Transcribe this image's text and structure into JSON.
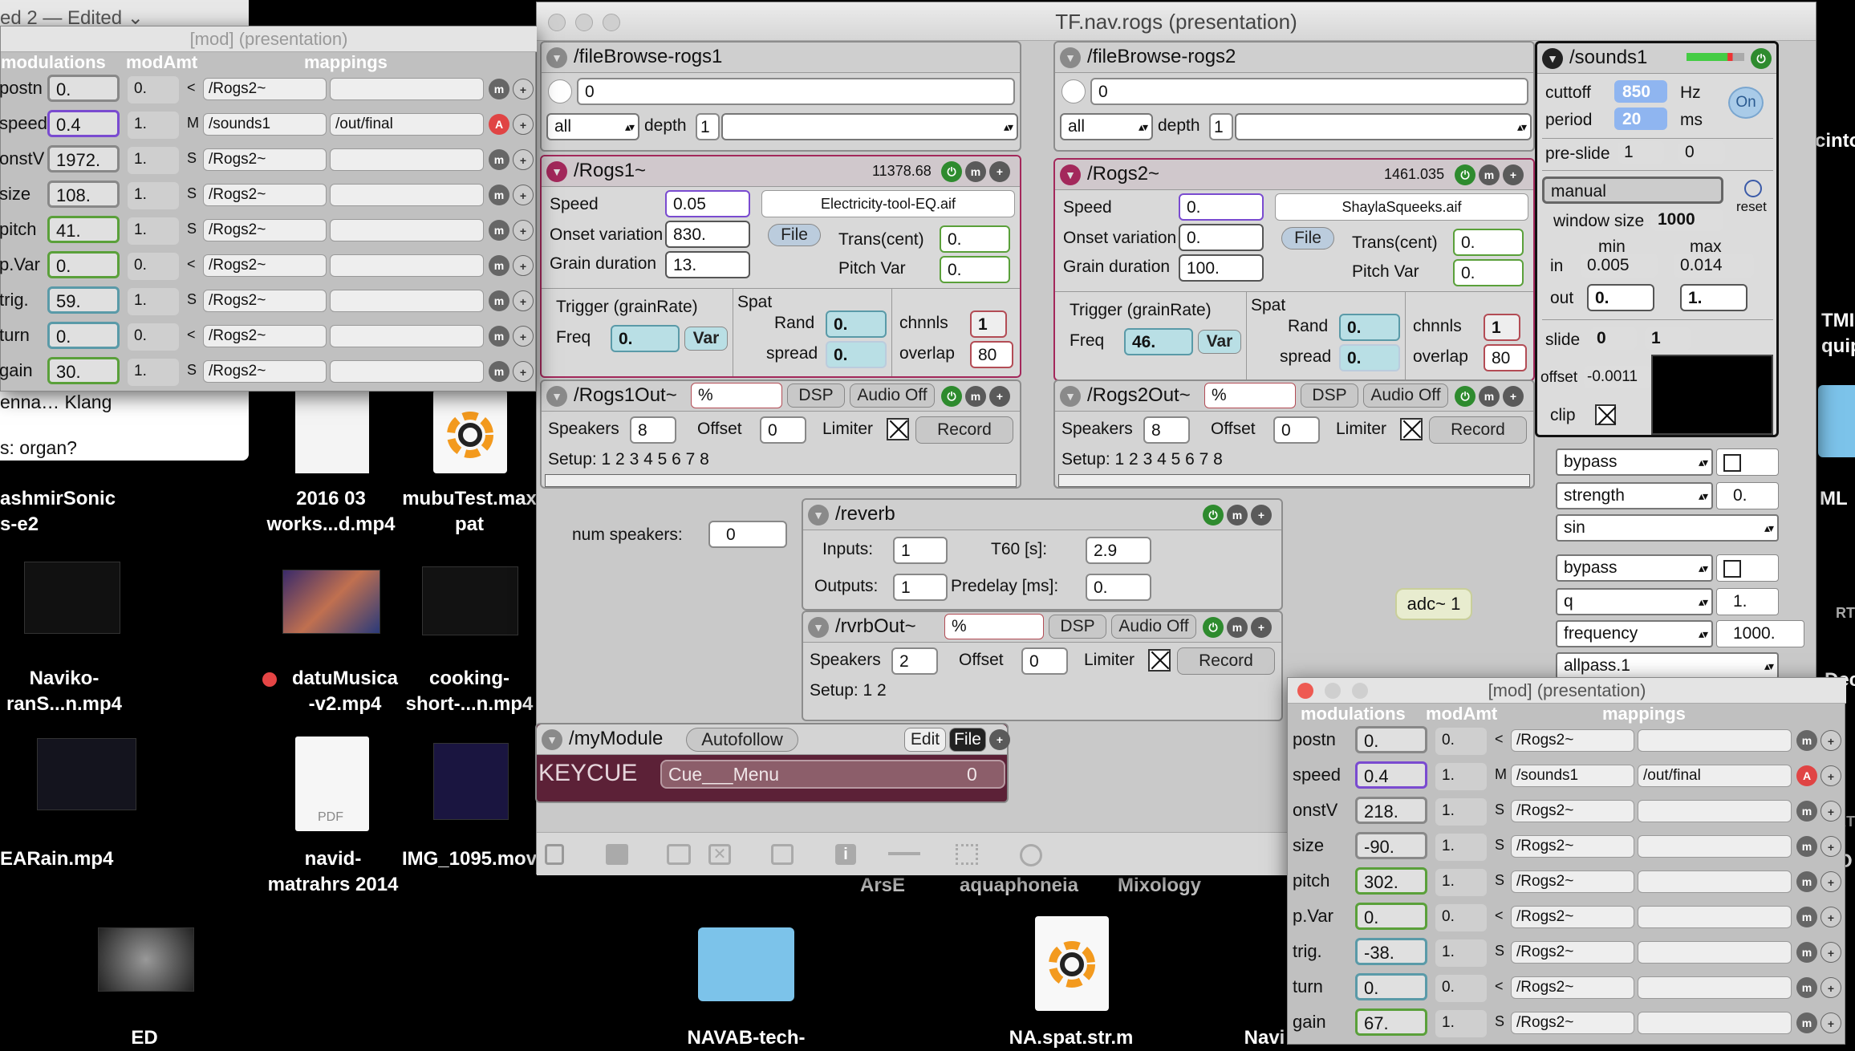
{
  "desktop": {
    "labels": {
      "kashmir": "ashmirSonic\ns-e2",
      "works": "2016 03\nworks...d.mp4",
      "mubu": "mubuTest.max\npat",
      "naviko": "Naviko-\nranS...n.mp4",
      "datum": "datuMusica\n-v2.mp4",
      "cooking": "cooking-\nshort-...n.mp4",
      "eararain": "EARain.mp4",
      "navid": "navid-\nmatrahrs 2014",
      "img": "IMG_1095.mov",
      "arse": "ArsE",
      "aqua": "aquaphoneia",
      "mix": "Mixology",
      "ed": "ED",
      "navab": "NAVAB-tech-",
      "naspat": "NA.spat.str.m",
      "navi": "Navi",
      "pdf": "PDF",
      "cinto": "cinto",
      "tmi": "TMI\nquipr",
      "ml": "ML",
      "rt": "RT",
      "dec": "Dec",
      "rt2": "RT",
      "o": "O"
    },
    "note_window": {
      "title": "ed 2 — Edited ⌄",
      "line1": "enna… Klang",
      "line2": "s: organ?"
    }
  },
  "main_window": {
    "title": "TF.nav.rogs (presentation)",
    "fb1": {
      "name": "/fileBrowse-rogs1",
      "path": "0",
      "filter": "all",
      "depth_label": "depth",
      "depth": "1"
    },
    "fb2": {
      "name": "/fileBrowse-rogs2",
      "path": "0",
      "filter": "all",
      "depth_label": "depth",
      "depth": "1"
    },
    "rogs1": {
      "name": "/Rogs1~",
      "time": "11378.68",
      "speed_label": "Speed",
      "speed": "0.05",
      "onset_label": "Onset variation",
      "onset": "830.",
      "grain_label": "Grain duration",
      "grain": "13.",
      "file_name": "Electricity-tool-EQ.aif",
      "file_btn": "File",
      "trans_label": "Trans(cent)",
      "trans": "0.",
      "pitchvar_label": "Pitch Var",
      "pitchvar": "0.",
      "trigger_label": "Trigger (grainRate)",
      "freq_label": "Freq",
      "freq": "0.",
      "var_btn": "Var",
      "spat_label": "Spat",
      "rand_label": "Rand",
      "rand": "0.",
      "spread_label": "spread",
      "spread": "0.",
      "chnls_label": "chnnls",
      "chnls": "1",
      "overlap_label": "overlap",
      "overlap": "80"
    },
    "rogs2": {
      "name": "/Rogs2~",
      "time": "1461.035",
      "speed_label": "Speed",
      "speed": "0.",
      "onset_label": "Onset variation",
      "onset": "0.",
      "grain_label": "Grain duration",
      "grain": "100.",
      "file_name": "ShaylaSqueeks.aif",
      "file_btn": "File",
      "trans_label": "Trans(cent)",
      "trans": "0.",
      "pitchvar_label": "Pitch Var",
      "pitchvar": "0.",
      "trigger_label": "Trigger (grainRate)",
      "freq_label": "Freq",
      "freq": "46.",
      "var_btn": "Var",
      "spat_label": "Spat",
      "rand_label": "Rand",
      "rand": "0.",
      "spread_label": "spread",
      "spread": "0.",
      "chnls_label": "chnnls",
      "chnls": "1",
      "overlap_label": "overlap",
      "overlap": "80"
    },
    "out1": {
      "name": "/Rogs1Out~",
      "pct": "%",
      "dsp": "DSP",
      "audio": "Audio Off",
      "spk_label": "Speakers",
      "spk": "8",
      "off_label": "Offset",
      "off": "0",
      "lim_label": "Limiter",
      "rec": "Record",
      "setup": "Setup:  1 2 3 4 5 6 7 8"
    },
    "out2": {
      "name": "/Rogs2Out~",
      "pct": "%",
      "dsp": "DSP",
      "audio": "Audio Off",
      "spk_label": "Speakers",
      "spk": "8",
      "off_label": "Offset",
      "off": "0",
      "lim_label": "Limiter",
      "rec": "Record",
      "setup": "Setup:  1 2 3 4 5 6 7 8"
    },
    "num_speakers_label": "num speakers:",
    "num_speakers": "0",
    "reverb": {
      "name": "/reverb",
      "in_label": "Inputs:",
      "inputs": "1",
      "out_label": "Outputs:",
      "outputs": "1",
      "t60_label": "T60 [s]:",
      "t60": "2.9",
      "pre_label": "Predelay [ms]:",
      "predelay": "0."
    },
    "rvrbout": {
      "name": "/rvrbOut~",
      "pct": "%",
      "dsp": "DSP",
      "audio": "Audio Off",
      "spk_label": "Speakers",
      "spk": "2",
      "off_label": "Offset",
      "off": "0",
      "lim_label": "Limiter",
      "rec": "Record",
      "setup": "Setup:  1 2"
    },
    "adc": "adc~ 1",
    "mymodule": {
      "name": "/myModule",
      "autofollow": "Autofollow",
      "edit": "Edit",
      "file": "File",
      "keycue": "KEYCUE",
      "cue_menu": "Cue___Menu",
      "cue_num": "0"
    },
    "sounds1": {
      "name": "/sounds1",
      "cutoff_label": "cuttoff",
      "cutoff": "850",
      "hz": "Hz",
      "period_label": "period",
      "period": "20",
      "ms": "ms",
      "on": "On",
      "preslide_label": "pre-slide",
      "preslide": "1",
      "preslide2": "0",
      "mode": "manual",
      "reset": "reset",
      "window_label": "window size",
      "window": "1000",
      "min_label": "min",
      "max_label": "max",
      "in_label": "in",
      "in_min": "0.005",
      "in_max": "0.014",
      "out_label": "out",
      "out_min": "0.",
      "out_max": "1.",
      "slide_label": "slide",
      "slide1": "0",
      "slide2": "1",
      "offset_label": "offset",
      "offset": "-0.0011",
      "clip_label": "clip"
    },
    "right_controls": {
      "bypass1": "bypass",
      "strength": "strength",
      "strength_val": "0.",
      "sin": "sin",
      "bypass2": "bypass",
      "q": "q",
      "q_val": "1.",
      "freq": "frequency",
      "freq_val": "1000.",
      "allpass": "allpass.1"
    }
  },
  "mod_left": {
    "title": "[mod] (presentation)",
    "h_mod": "modulations",
    "h_amt": "modAmt",
    "h_map": "mappings",
    "rows": [
      {
        "name": "postn",
        "val": "0.",
        "amt": "0.",
        "op": "<",
        "dest": "/Rogs2~",
        "dest2": "",
        "color": "gray"
      },
      {
        "name": "speed",
        "val": "0.4",
        "amt": "1.",
        "op": "M",
        "dest": "/sounds1",
        "dest2": "/out/final",
        "color": "purple"
      },
      {
        "name": "onstV",
        "val": "1972.",
        "amt": "1.",
        "op": "S",
        "dest": "/Rogs2~",
        "dest2": "",
        "color": "gray"
      },
      {
        "name": "size",
        "val": "108.",
        "amt": "1.",
        "op": "S",
        "dest": "/Rogs2~",
        "dest2": "",
        "color": "gray"
      },
      {
        "name": "pitch",
        "val": "41.",
        "amt": "1.",
        "op": "S",
        "dest": "/Rogs2~",
        "dest2": "",
        "color": "green"
      },
      {
        "name": "p.Var",
        "val": "0.",
        "amt": "0.",
        "op": "<",
        "dest": "/Rogs2~",
        "dest2": "",
        "color": "green"
      },
      {
        "name": "trig.",
        "val": "59.",
        "amt": "1.",
        "op": "S",
        "dest": "/Rogs2~",
        "dest2": "",
        "color": "teal"
      },
      {
        "name": "turn",
        "val": "0.",
        "amt": "0.",
        "op": "<",
        "dest": "/Rogs2~",
        "dest2": "",
        "color": "teal"
      },
      {
        "name": "gain",
        "val": "30.",
        "amt": "1.",
        "op": "S",
        "dest": "/Rogs2~",
        "dest2": "",
        "color": "green"
      }
    ]
  },
  "mod_right": {
    "title": "[mod] (presentation)",
    "h_mod": "modulations",
    "h_amt": "modAmt",
    "h_map": "mappings",
    "rows": [
      {
        "name": "postn",
        "val": "0.",
        "amt": "0.",
        "op": "<",
        "dest": "/Rogs2~",
        "dest2": "",
        "color": "gray"
      },
      {
        "name": "speed",
        "val": "0.4",
        "amt": "1.",
        "op": "M",
        "dest": "/sounds1",
        "dest2": "/out/final",
        "color": "purple"
      },
      {
        "name": "onstV",
        "val": "218.",
        "amt": "1.",
        "op": "S",
        "dest": "/Rogs2~",
        "dest2": "",
        "color": "gray"
      },
      {
        "name": "size",
        "val": "-90.",
        "amt": "1.",
        "op": "S",
        "dest": "/Rogs2~",
        "dest2": "",
        "color": "gray"
      },
      {
        "name": "pitch",
        "val": "302.",
        "amt": "1.",
        "op": "S",
        "dest": "/Rogs2~",
        "dest2": "",
        "color": "green"
      },
      {
        "name": "p.Var",
        "val": "0.",
        "amt": "0.",
        "op": "<",
        "dest": "/Rogs2~",
        "dest2": "",
        "color": "green"
      },
      {
        "name": "trig.",
        "val": "-38.",
        "amt": "1.",
        "op": "S",
        "dest": "/Rogs2~",
        "dest2": "",
        "color": "teal"
      },
      {
        "name": "turn",
        "val": "0.",
        "amt": "0.",
        "op": "<",
        "dest": "/Rogs2~",
        "dest2": "",
        "color": "teal"
      },
      {
        "name": "gain",
        "val": "67.",
        "amt": "1.",
        "op": "S",
        "dest": "/Rogs2~",
        "dest2": "",
        "color": "green"
      }
    ]
  }
}
